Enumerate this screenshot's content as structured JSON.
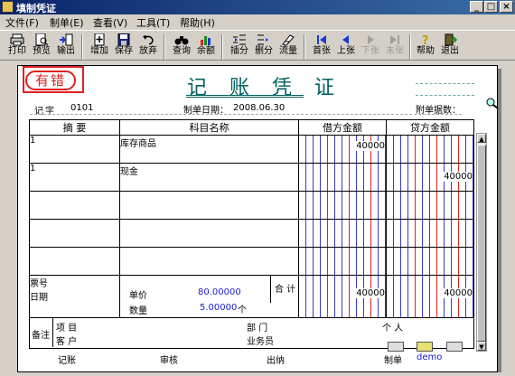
{
  "window": {
    "title": "填制凭证"
  },
  "menu": [
    "文件(F)",
    "制单(E)",
    "查看(V)",
    "工具(T)",
    "帮助(H)"
  ],
  "toolbar": {
    "print": "打印",
    "preview": "预览",
    "export": "输出",
    "add": "增加",
    "save": "保存",
    "discard": "放弃",
    "query": "查询",
    "balance": "余额",
    "insert_row": "插分",
    "delete_row": "删分",
    "flow": "流量",
    "first": "首张",
    "prev": "上张",
    "next": "下张",
    "last": "末张",
    "help": "帮助",
    "exit": "退出"
  },
  "voucher": {
    "stamp": "有错",
    "title": "记 账 凭 证",
    "type_label": "记",
    "number_label": "字",
    "number": "0101",
    "date_label": "制单日期：",
    "date": "2008.06.30",
    "attach_label": "附单据数："
  },
  "columns": {
    "summary": "摘 要",
    "account": "科目名称",
    "debit": "借方金额",
    "credit": "贷方金额"
  },
  "entries": [
    {
      "summary": "1",
      "account": "库存商品",
      "debit": "40000",
      "credit": ""
    },
    {
      "summary": "1",
      "account": "现金",
      "debit": "",
      "credit": "40000"
    },
    {
      "summary": "",
      "account": "",
      "debit": "",
      "credit": ""
    },
    {
      "summary": "",
      "account": "",
      "debit": "",
      "credit": ""
    },
    {
      "summary": "",
      "account": "",
      "debit": "",
      "credit": ""
    }
  ],
  "footer_left": {
    "ticket_label": "票号",
    "date_label": "日期"
  },
  "footer_mid": {
    "price_label": "单价",
    "price": "80.00000",
    "qty_label": "数量",
    "qty": "5.00000",
    "qty_unit": "个"
  },
  "totals": {
    "label": "合 计",
    "debit": "40000",
    "credit": "40000"
  },
  "remarks": {
    "label": "备注",
    "project_label": "项 目",
    "customer_label": "客 户",
    "dept_label": "部 门",
    "salesman_label": "业务员",
    "person_label": "个 人"
  },
  "signatures": {
    "bookkeeper": "记账",
    "reviewer": "审核",
    "cashier": "出纳",
    "maker_label": "制单",
    "maker": "demo"
  }
}
